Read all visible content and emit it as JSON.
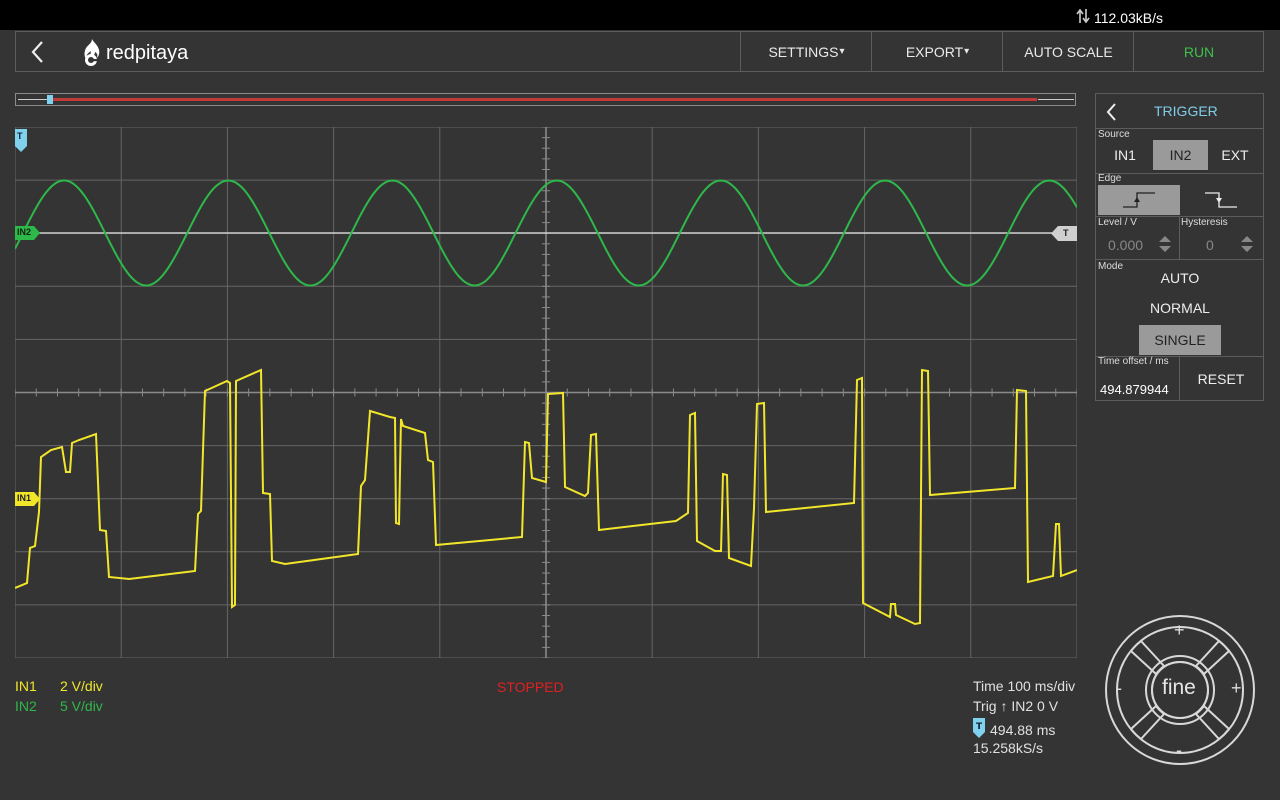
{
  "status_bar": {
    "net_rate": "112.03kB/s",
    "net_icon": "up-down-arrows-icon"
  },
  "header": {
    "logo_text": "redpitaya",
    "menu": {
      "settings": "SETTINGS",
      "export": "EXPORT",
      "auto_scale": "AUTO SCALE",
      "run": "RUN"
    },
    "run_color": "#3fc04a"
  },
  "plot": {
    "trigger_marker": "T",
    "in1_marker": "IN1",
    "in2_marker": "IN2",
    "trigger_level_marker": "T",
    "colors": {
      "in1": "#f2e62a",
      "in2": "#2fb84a",
      "grid": "#666666",
      "trigger": "#7fd1ee"
    }
  },
  "trigger_panel": {
    "title": "TRIGGER",
    "source_label": "Source",
    "sources": [
      "IN1",
      "IN2",
      "EXT"
    ],
    "selected_source": "IN2",
    "edge_label": "Edge",
    "edges": [
      "rising-edge-icon",
      "falling-edge-icon"
    ],
    "selected_edge": "rising",
    "level_label": "Level / V",
    "level_value": "0.000",
    "hysteresis_label": "Hysteresis",
    "hysteresis_value": "0",
    "mode_label": "Mode",
    "modes": [
      "AUTO",
      "NORMAL",
      "SINGLE"
    ],
    "selected_mode": "SINGLE",
    "time_offset_label": "Time offset / ms",
    "time_offset_value": "494.879944",
    "reset_label": "RESET"
  },
  "legend": {
    "in1_name": "IN1",
    "in1_scale": "2 V/div",
    "in2_name": "IN2",
    "in2_scale": "5 V/div"
  },
  "status": "STOPPED",
  "info": {
    "time": "Time 100 ms/div",
    "trig": "Trig ↑ IN2 0 V",
    "offset": "494.88 ms",
    "sample_rate": "15.258kS/s"
  },
  "jog_wheel": {
    "center": "fine",
    "top": "+",
    "bottom": "-",
    "left": "-",
    "right": "+"
  }
}
